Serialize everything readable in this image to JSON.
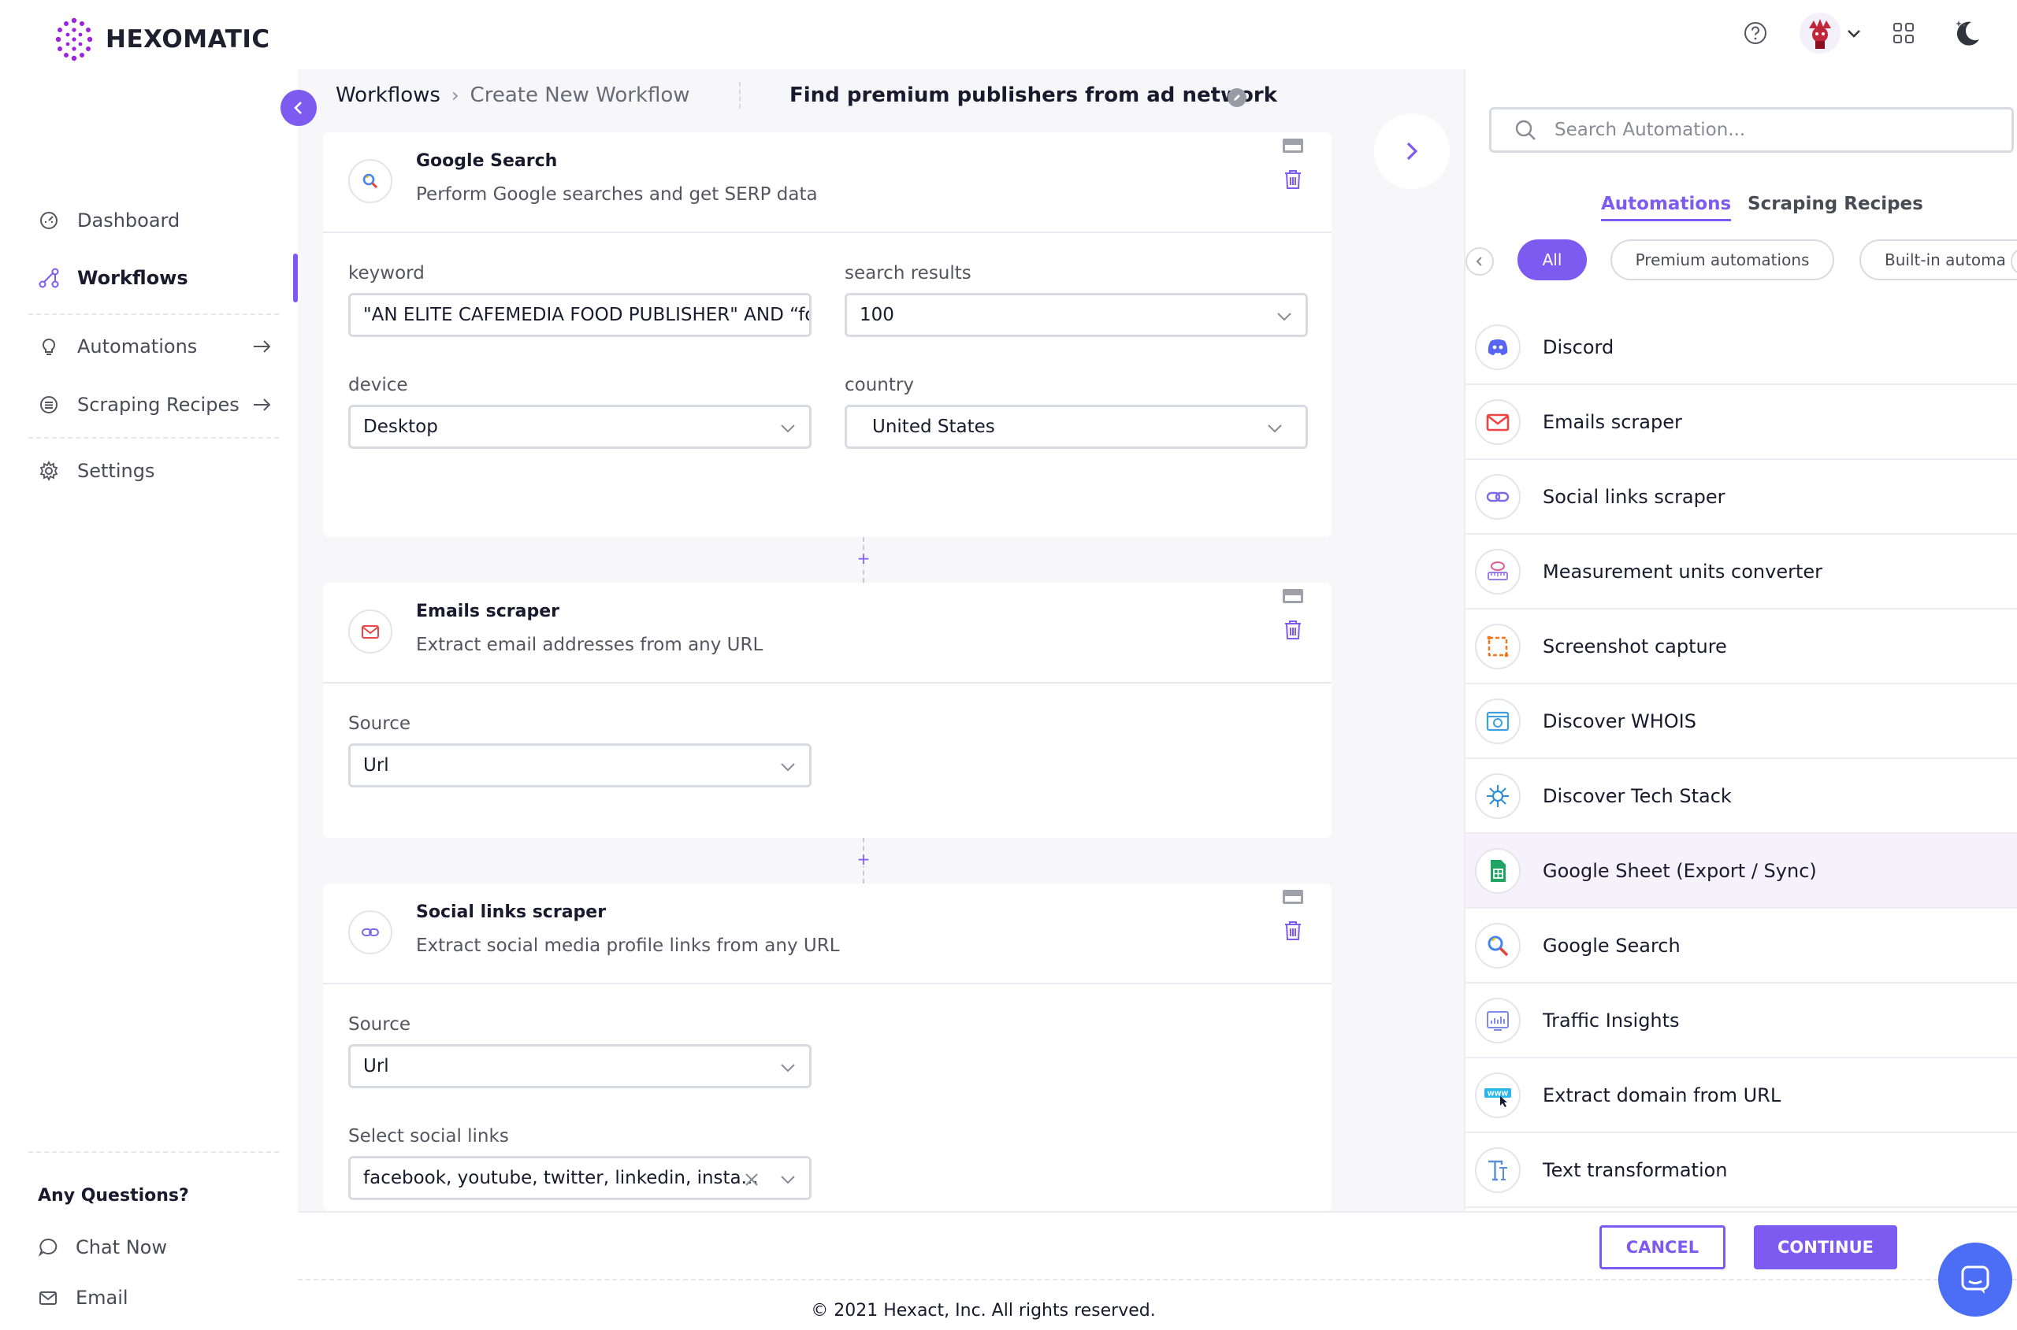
{
  "brand": {
    "name": "HEXOMATIC",
    "color": "#7d5bf0"
  },
  "sidebar": {
    "items": [
      {
        "label": "Dashboard",
        "icon": "dashboard-icon"
      },
      {
        "label": "Workflows",
        "icon": "workflow-icon",
        "active": true
      },
      {
        "label": "Automations",
        "icon": "bulb-icon",
        "arrow": true
      },
      {
        "label": "Scraping Recipes",
        "icon": "recipe-icon",
        "arrow": true
      },
      {
        "label": "Settings",
        "icon": "gear-icon"
      }
    ],
    "questions_title": "Any Questions?",
    "help": [
      {
        "label": "Chat Now",
        "icon": "chat-icon"
      },
      {
        "label": "Email",
        "icon": "mail-icon"
      }
    ]
  },
  "topbar": {
    "icons": [
      "help-icon",
      "avatar",
      "chevron-down-icon",
      "apps-grid-icon",
      "dark-mode-icon"
    ]
  },
  "breadcrumb": {
    "root": "Workflows",
    "current": "Create New Workflow"
  },
  "workflow": {
    "title": "Find premium publishers from ad network",
    "steps": [
      {
        "title": "Google Search",
        "description": "Perform Google searches and get SERP data",
        "icon": "google-search-icon",
        "fields": {
          "keyword_label": "keyword",
          "keyword_value": "\"AN ELITE CAFEMEDIA FOOD PUBLISHER\" AND “food b",
          "results_label": "search results",
          "results_value": "100",
          "device_label": "device",
          "device_value": "Desktop",
          "country_label": "country",
          "country_value": "United States"
        }
      },
      {
        "title": "Emails scraper",
        "description": "Extract email addresses from any URL",
        "icon": "mail-icon",
        "fields": {
          "source_label": "Source",
          "source_value": "Url"
        }
      },
      {
        "title": "Social links scraper",
        "description": "Extract social media profile links from any URL",
        "icon": "link-icon",
        "fields": {
          "source_label": "Source",
          "source_value": "Url",
          "social_label": "Select social links",
          "social_value": "facebook, youtube, twitter, linkedin, insta..."
        }
      }
    ],
    "connector_symbol": "+"
  },
  "panel": {
    "search_placeholder": "Search Automation...",
    "tabs": {
      "automations": "Automations",
      "recipes": "Scraping Recipes"
    },
    "chips": [
      "All",
      "Premium automations",
      "Built-in automa"
    ],
    "automations": [
      {
        "label": "Discord",
        "icon": "discord-icon"
      },
      {
        "label": "Emails scraper",
        "icon": "mail-icon"
      },
      {
        "label": "Social links scraper",
        "icon": "link-icon"
      },
      {
        "label": "Measurement units converter",
        "icon": "scale-icon"
      },
      {
        "label": "Screenshot capture",
        "icon": "screenshot-icon"
      },
      {
        "label": "Discover WHOIS",
        "icon": "whois-icon"
      },
      {
        "label": "Discover Tech Stack",
        "icon": "tech-stack-icon"
      },
      {
        "label": "Google Sheet (Export / Sync)",
        "icon": "google-sheet-icon",
        "highlight": true
      },
      {
        "label": "Google Search",
        "icon": "google-search-icon"
      },
      {
        "label": "Traffic Insights",
        "icon": "traffic-icon"
      },
      {
        "label": "Extract domain from URL",
        "icon": "www-icon"
      },
      {
        "label": "Text transformation",
        "icon": "text-icon"
      }
    ]
  },
  "footer": {
    "cancel": "CANCEL",
    "continue": "CONTINUE",
    "copyright": "© 2021 Hexact, Inc. All rights reserved."
  }
}
